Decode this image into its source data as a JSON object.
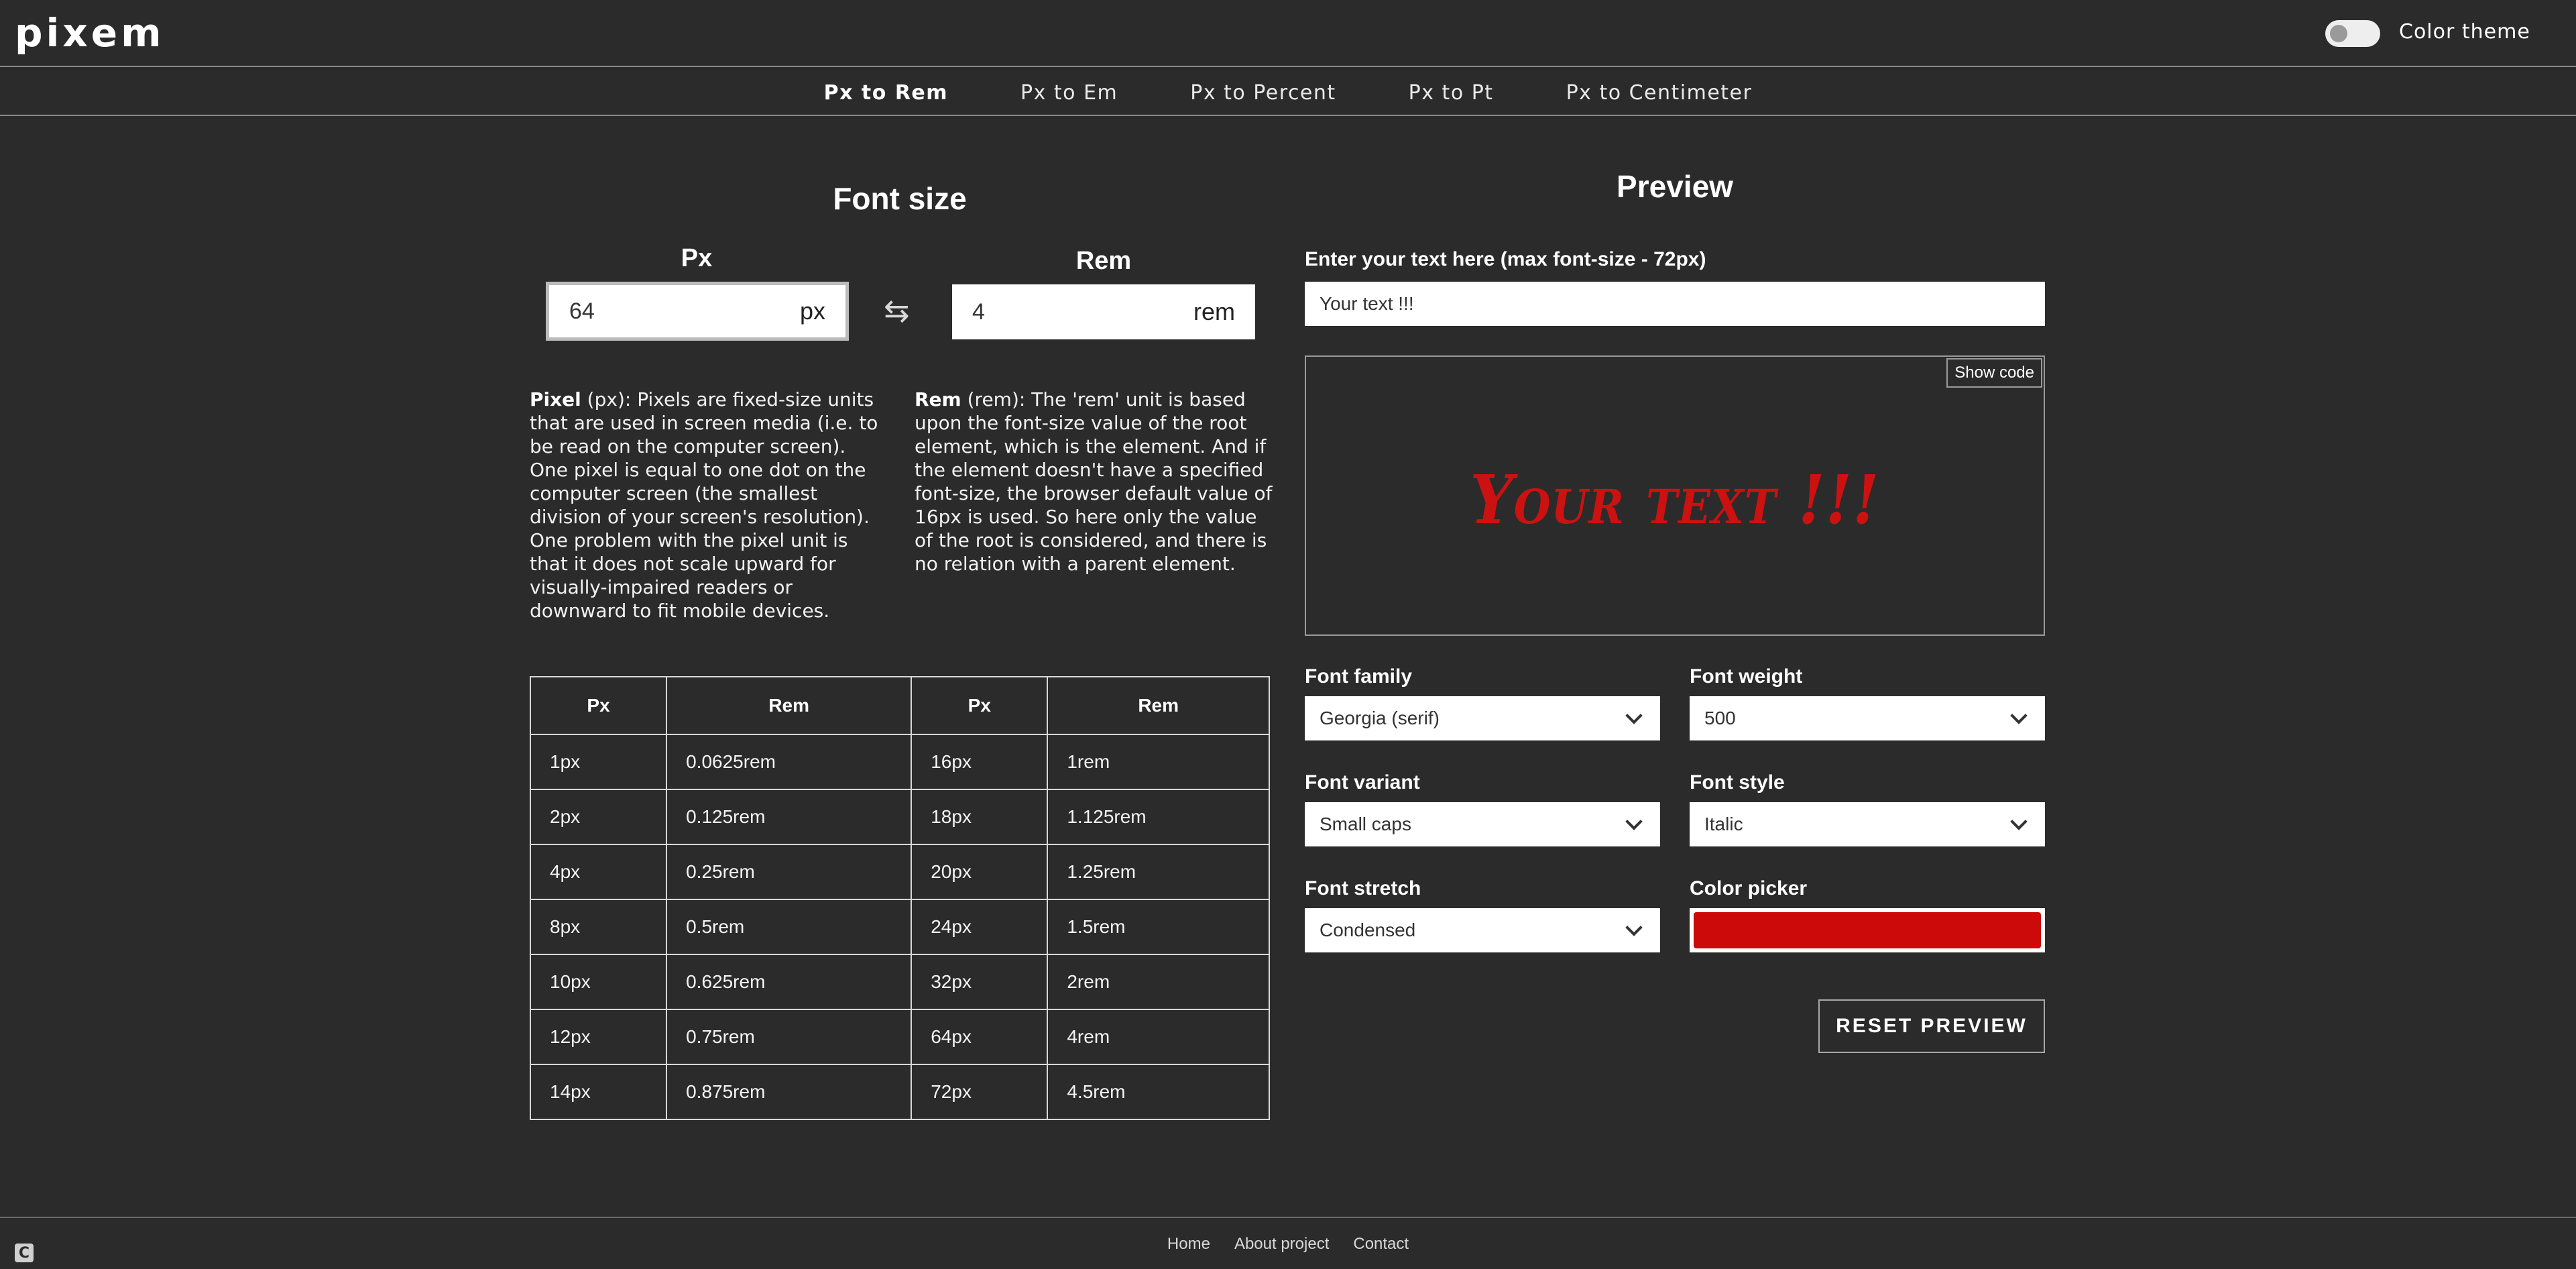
{
  "app": {
    "logo": "pixem",
    "theme_label": "Color theme",
    "theme_on": false
  },
  "nav": [
    {
      "label": "Px to Rem",
      "active": true
    },
    {
      "label": "Px to Em"
    },
    {
      "label": "Px to Percent"
    },
    {
      "label": "Px to Pt"
    },
    {
      "label": "Px to Centimeter"
    }
  ],
  "converter": {
    "title": "Font size",
    "px_label": "Px",
    "px_value": "64",
    "px_unit": "px",
    "rem_label": "Rem",
    "rem_value": "4",
    "rem_unit": "rem",
    "swap_icon": "swap-arrows-icon",
    "px_desc_term": "Pixel",
    "px_desc": " (px): Pixels are fixed-size units that are used in screen media (i.e. to be read on the computer screen). One pixel is equal to one dot on the computer screen (the smallest division of your screen's resolution). One problem with the pixel unit is that it does not scale upward for visually-impaired readers or downward to fit mobile devices.",
    "rem_desc_term": "Rem",
    "rem_desc": " (rem): The 'rem' unit is based upon the font-size value of the root element, which is the element. And if the element doesn't have a specified font-size, the browser default value of 16px is used. So here only the value of the root is considered, and there is no relation with a parent element."
  },
  "table": {
    "headers": [
      "Px",
      "Rem",
      "Px",
      "Rem"
    ],
    "rows": [
      [
        "1px",
        "0.0625rem",
        "16px",
        "1rem"
      ],
      [
        "2px",
        "0.125rem",
        "18px",
        "1.125rem"
      ],
      [
        "4px",
        "0.25rem",
        "20px",
        "1.25rem"
      ],
      [
        "8px",
        "0.5rem",
        "24px",
        "1.5rem"
      ],
      [
        "10px",
        "0.625rem",
        "32px",
        "2rem"
      ],
      [
        "12px",
        "0.75rem",
        "64px",
        "4rem"
      ],
      [
        "14px",
        "0.875rem",
        "72px",
        "4.5rem"
      ]
    ]
  },
  "preview": {
    "title": "Preview",
    "text_label": "Enter your text here (max font-size - 72px)",
    "text_value": "Your text !!!",
    "show_code_label": "Show code",
    "text_color": "#cc1111",
    "fields": {
      "font_family": {
        "label": "Font family",
        "value": "Georgia (serif)"
      },
      "font_weight": {
        "label": "Font weight",
        "value": "500"
      },
      "font_variant": {
        "label": "Font variant",
        "value": "Small caps"
      },
      "font_style": {
        "label": "Font style",
        "value": "Italic"
      },
      "font_stretch": {
        "label": "Font stretch",
        "value": "Condensed"
      },
      "color_picker": {
        "label": "Color picker",
        "value": "#cc0a0a"
      }
    },
    "reset_label": "RESET PREVIEW"
  },
  "footer": {
    "links": [
      "Home",
      "About project",
      "Contact"
    ],
    "corner_icon": "C"
  }
}
